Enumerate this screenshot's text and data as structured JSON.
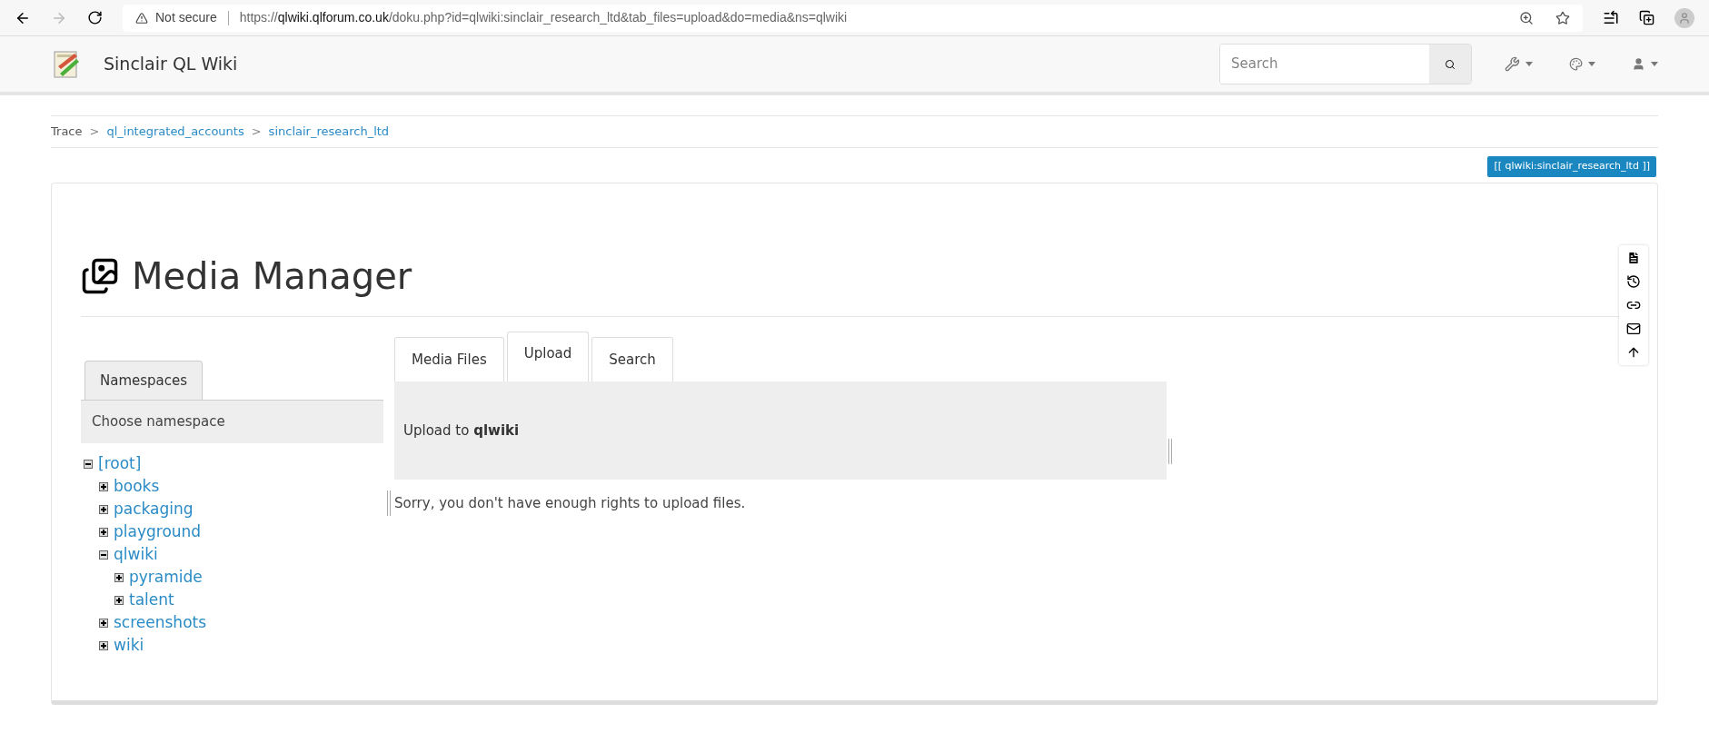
{
  "browser": {
    "security": "Not secure",
    "url": {
      "scheme": "https://",
      "host": "qlwiki.qlforum.co.uk",
      "path": "/doku.php?id=qlwiki:sinclair_research_ltd&tab_files=upload&do=media&ns=qlwiki"
    }
  },
  "site": {
    "title": "Sinclair QL Wiki",
    "search": {
      "placeholder": "Search"
    }
  },
  "breadcrumb": {
    "label": "Trace",
    "separator": ">",
    "items": [
      "ql_integrated_accounts",
      "sinclair_research_ltd"
    ]
  },
  "page_id": "[[ qlwiki:sinclair_research_ltd ]]",
  "heading": "Media Manager",
  "namespaces": {
    "tab": "Namespaces",
    "header": "Choose namespace",
    "tree": [
      {
        "label": "[root]",
        "expanded": true,
        "children": [
          {
            "label": "books",
            "expanded": false
          },
          {
            "label": "packaging",
            "expanded": false
          },
          {
            "label": "playground",
            "expanded": false
          },
          {
            "label": "qlwiki",
            "expanded": true,
            "children": [
              {
                "label": "pyramide",
                "expanded": false
              },
              {
                "label": "talent",
                "expanded": false
              }
            ]
          },
          {
            "label": "screenshots",
            "expanded": false
          },
          {
            "label": "wiki",
            "expanded": false
          }
        ]
      }
    ]
  },
  "tabs": [
    {
      "label": "Media Files",
      "selected": false
    },
    {
      "label": "Upload",
      "selected": true
    },
    {
      "label": "Search",
      "selected": false
    }
  ],
  "upload": {
    "title": "Upload to **qlwiki**",
    "message": "Sorry, you don't have enough rights to upload files."
  }
}
